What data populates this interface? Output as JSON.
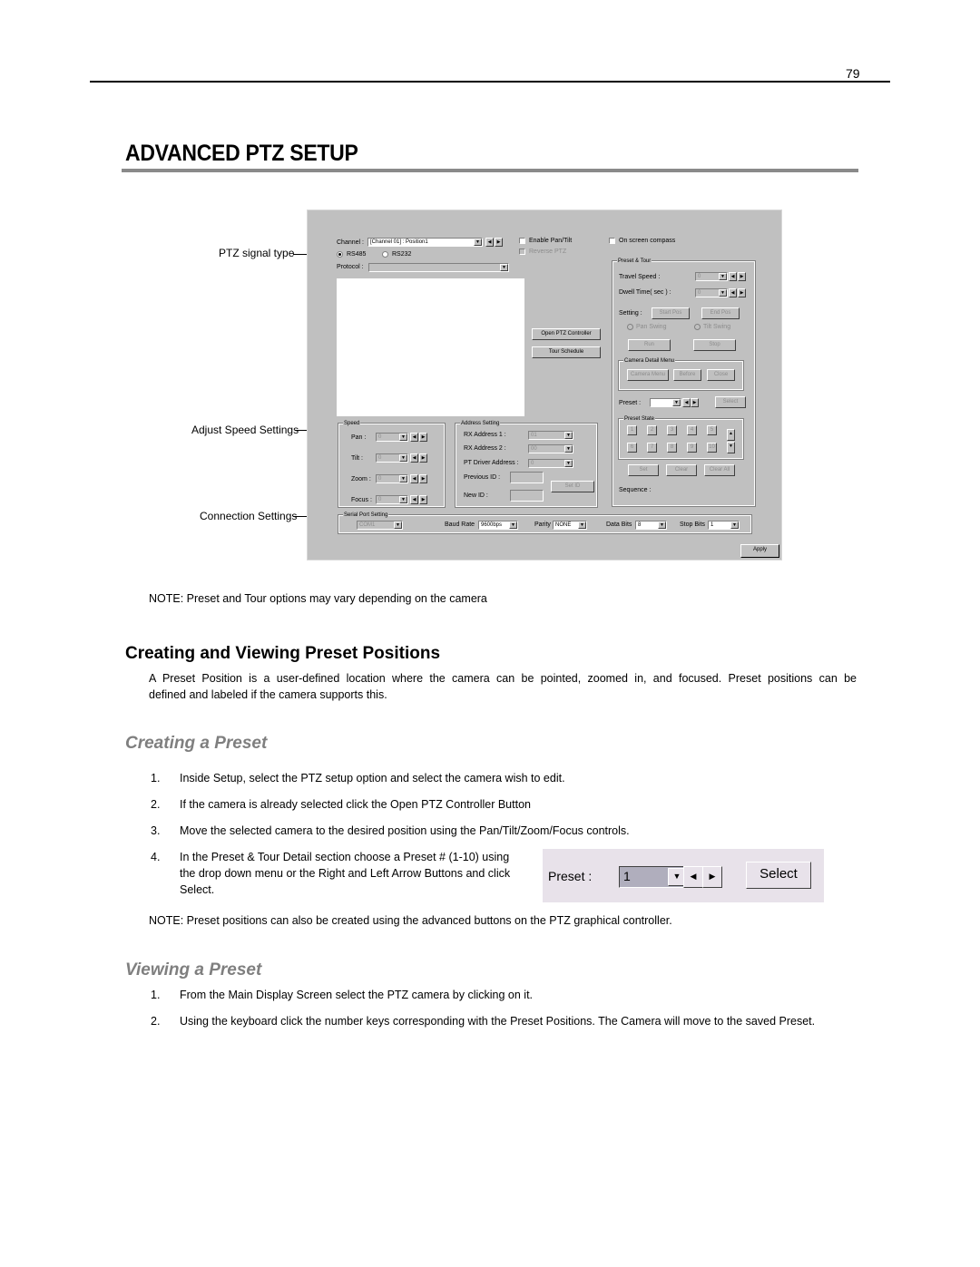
{
  "page": {
    "number": "79",
    "title": "ADVANCED PTZ SETUP"
  },
  "screenshot": {
    "channel_label": "Channel :",
    "channel_value": "[Channel 01] : Position1",
    "enable_pan_tilt": "Enable Pan/Tilt",
    "reverse_ptz": "Reverse PTZ",
    "on_screen_compass": "On screen compass",
    "rs485": "RS485",
    "rs232": "RS232",
    "protocol_label": "Protocol :",
    "open_ptz_controller": "Open PTZ Controller",
    "tour_schedule": "Tour Schedule",
    "preset_tour": {
      "title": "Preset & Tour",
      "travel_speed_label": "Travel Speed :",
      "travel_speed_value": "0",
      "dwell_time_label": "Dwell Time( sec ) :",
      "dwell_time_value": "0",
      "setting_label": "Setting :",
      "start_pos": "Start Pos",
      "end_pos": "End Pos",
      "pan_swing": "Pan Swing",
      "tilt_swing": "Tilt Swing",
      "run": "Run",
      "stop": "Stop"
    },
    "camera_detail_menu": {
      "title": "Camera Detail Menu",
      "camera_menu": "Camera Menu",
      "before": "Before",
      "close": "Close"
    },
    "preset_label": "Preset :",
    "select": "Select",
    "preset_state": {
      "title": "Preset State",
      "numbers": [
        "1",
        "2",
        "3",
        "4",
        "5",
        "6",
        "7",
        "8",
        "9",
        "10"
      ]
    },
    "set": "Set",
    "clear": "Clear",
    "clear_all": "Clear All",
    "sequence_label": "Sequence :",
    "speed": {
      "title": "Speed",
      "rows": [
        {
          "label": "Pan :",
          "value": "0"
        },
        {
          "label": "Tilt :",
          "value": "0"
        },
        {
          "label": "Zoom :",
          "value": "0"
        },
        {
          "label": "Focus :",
          "value": "0"
        }
      ]
    },
    "address": {
      "title": "Address Setting",
      "rx1_label": "RX Address 1 :",
      "rx1_value": "01",
      "rx2_label": "RX Address 2 :",
      "rx2_value": "00",
      "pt_driver_label": "PT Driver Address :",
      "pt_driver_value": "0",
      "previous_id_label": "Previous ID :",
      "new_id_label": "New ID :",
      "set_id": "Set ID"
    },
    "serial": {
      "title": "Serial Port Setting",
      "port_value": "COM1",
      "baud_label": "Baud Rate",
      "baud_value": "9600bps",
      "parity_label": "Parity",
      "parity_value": "NONE",
      "data_bits_label": "Data Bits",
      "data_bits_value": "8",
      "stop_bits_label": "Stop Bits",
      "stop_bits_value": "1"
    },
    "apply": "Apply"
  },
  "callouts": {
    "ptz_signal_type": "PTZ signal type",
    "adjust_speed": "Adjust Speed Settings",
    "connection": "Connection Settings"
  },
  "note1": "NOTE: Preset and Tour options may vary depending on the camera",
  "section": {
    "title": "Creating and Viewing Preset Positions",
    "para_line1": "A Preset Position is a user-defined location where the camera can be pointed, zoomed in, and focused.  Preset positions can be",
    "para_line2": "defined and labeled if the camera supports this."
  },
  "creating": {
    "title": "Creating a Preset",
    "steps": [
      {
        "num": "1.",
        "text": "Inside Setup, select the PTZ setup option and select the camera wish to edit."
      },
      {
        "num": "2.",
        "text": "If the camera is already selected click the Open PTZ Controller Button"
      },
      {
        "num": "3.",
        "text": "Move the selected camera to the desired position using the Pan/Tilt/Zoom/Focus controls."
      },
      {
        "num": "4.",
        "text_line1": "In the Preset & Tour Detail section choose a Preset # (1-10) using",
        "text_line2": "the drop down menu or the Right and Left Arrow Buttons and click",
        "text_line3": "Select."
      }
    ],
    "snippet": {
      "preset_label": "Preset :",
      "preset_value": "1",
      "select_label": "Select"
    },
    "note": "NOTE: Preset positions can also be created using the advanced buttons on the PTZ graphical controller."
  },
  "viewing": {
    "title": "Viewing a Preset",
    "steps": [
      {
        "num": "1.",
        "text": "From the Main Display Screen select the PTZ camera by clicking on it."
      },
      {
        "num": "2.",
        "text": "Using the keyboard click the number keys corresponding with the Preset Positions.  The Camera will move to the saved Preset."
      }
    ]
  }
}
